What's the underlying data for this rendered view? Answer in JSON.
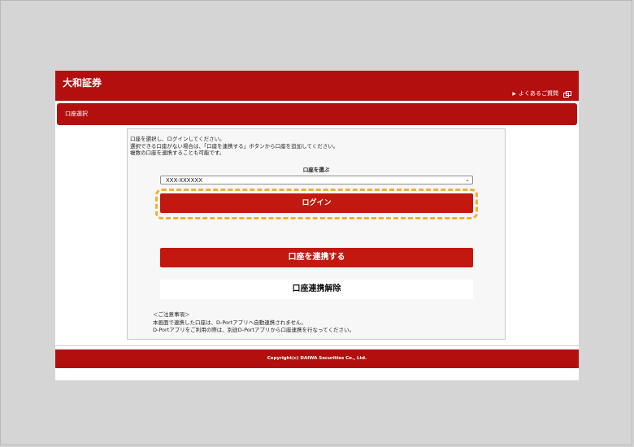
{
  "header": {
    "logo": "大和証券",
    "faq_link": "よくあるご質問"
  },
  "subheader": {
    "title": "口座選択"
  },
  "intro": {
    "line1": "口座を選択し、ログインしてください。",
    "line2": "選択できる口座がない場合は、「口座を連携する」ボタンから口座を追加してください。",
    "line3": "複数の口座を連携することも可能です。"
  },
  "account_select": {
    "label": "口座を選ぶ",
    "value": "XXX-XXXXXX"
  },
  "buttons": {
    "login": "ログイン",
    "link_account": "口座を連携する",
    "unlink_account": "口座連携解除"
  },
  "notes": {
    "heading": "＜ご注意事項＞",
    "line1": "本画面で連携した口座は、D-Portアプリへ自動連携されません。",
    "line2": "D-Portアプリをご利用の際は、別途D-Portアプリから口座連携を行なってください。"
  },
  "footer": {
    "copyright": "Copyright(c) DAIWA Securities Co., Ltd."
  },
  "colors": {
    "brand_red": "#b30f0f",
    "button_red": "#c3180f",
    "highlight": "#f0b133"
  }
}
